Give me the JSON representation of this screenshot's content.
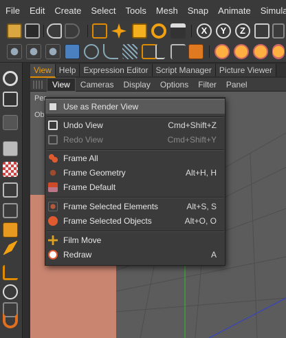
{
  "menubar": {
    "items": [
      "File",
      "Edit",
      "Create",
      "Select",
      "Tools",
      "Mesh",
      "Snap",
      "Animate",
      "Simulate"
    ]
  },
  "toolbar": {
    "axis_x": "X",
    "axis_y": "Y",
    "axis_z": "Z"
  },
  "panel_tabs": [
    "View",
    "Help",
    "Expression Editor",
    "Script Manager",
    "Picture Viewer"
  ],
  "viewport_menu": [
    "View",
    "Cameras",
    "Display",
    "Options",
    "Filter",
    "Panel"
  ],
  "viewport": {
    "label_persp": "Per",
    "label_obj": "Ob"
  },
  "view_menu": {
    "items": [
      {
        "label": "Use as Render View",
        "shortcut": ""
      },
      {
        "label": "Undo View",
        "shortcut": "Cmd+Shift+Z"
      },
      {
        "label": "Redo View",
        "shortcut": "Cmd+Shift+Y"
      },
      {
        "label": "Frame All",
        "shortcut": ""
      },
      {
        "label": "Frame Geometry",
        "shortcut": "Alt+H, H"
      },
      {
        "label": "Frame Default",
        "shortcut": ""
      },
      {
        "label": "Frame Selected Elements",
        "shortcut": "Alt+S, S"
      },
      {
        "label": "Frame Selected Objects",
        "shortcut": "Alt+O, O"
      },
      {
        "label": "Film Move",
        "shortcut": ""
      },
      {
        "label": "Redraw",
        "shortcut": "A"
      }
    ]
  },
  "colors": {
    "accent_orange": "#e08a00",
    "menu_bg": "#3b3b3b",
    "highlight": "#5a5a5a",
    "floor": "#c98570",
    "viewport_bg": "#5c5c5c"
  }
}
